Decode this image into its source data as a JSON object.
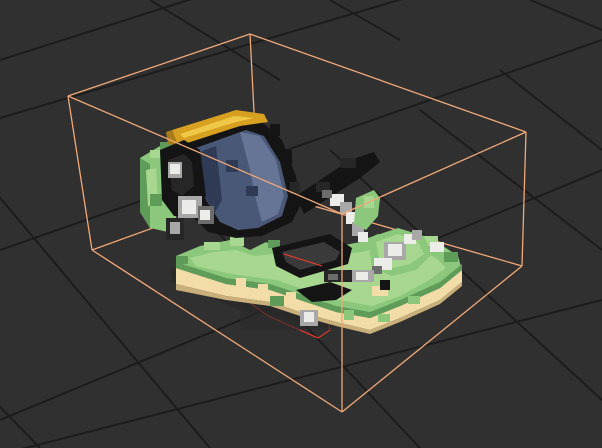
{
  "viewport": {
    "background_color": "#303030",
    "grid_color": "#1c1c1c",
    "bounding_box_color": "#f0a878",
    "selection_color": "#ff3a2a"
  },
  "model": {
    "icon": "voxel-model-icon",
    "palette": {
      "green_light": "#a8d890",
      "green": "#8cc87c",
      "green_dark": "#5f9c5a",
      "green_shadow": "#3f6b44",
      "sand": "#f2dca8",
      "sand_dark": "#c9b07a",
      "navy": "#4a5878",
      "navy_light": "#667495",
      "navy_dark": "#2f3a55",
      "black": "#141414",
      "charcoal": "#262626",
      "gold": "#d8a020",
      "gold_light": "#f0c848",
      "white": "#ecece8",
      "grey": "#a8a8a8",
      "grey_dark": "#6c6c6c"
    }
  }
}
